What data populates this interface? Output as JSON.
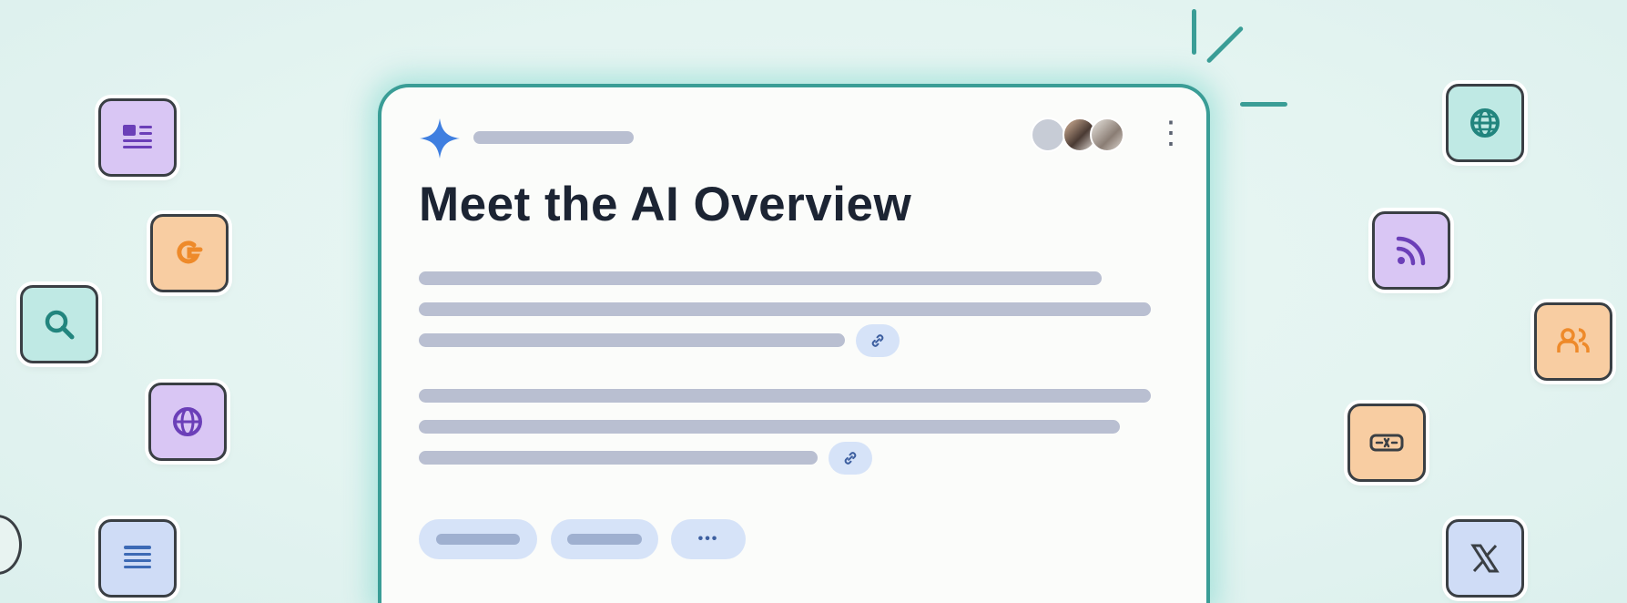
{
  "card": {
    "title": "Meet the AI Overview",
    "menu_glyph": "⋮",
    "more_glyph": "•••"
  },
  "icons": {
    "left": [
      "news-icon",
      "google-icon",
      "search-icon",
      "globe-icon",
      "document-icon"
    ],
    "right": [
      "web-icon",
      "rss-icon",
      "people-icon",
      "badge-icon",
      "x-icon"
    ]
  },
  "colors": {
    "accent": "#3a9d96",
    "tile_purple": "#d9c6f4",
    "tile_orange": "#f8cda2",
    "tile_teal": "#bfe9e4",
    "tile_blue": "#cfdcf6",
    "sparkle": "#3f7fe0",
    "title_text": "#1c2433"
  }
}
